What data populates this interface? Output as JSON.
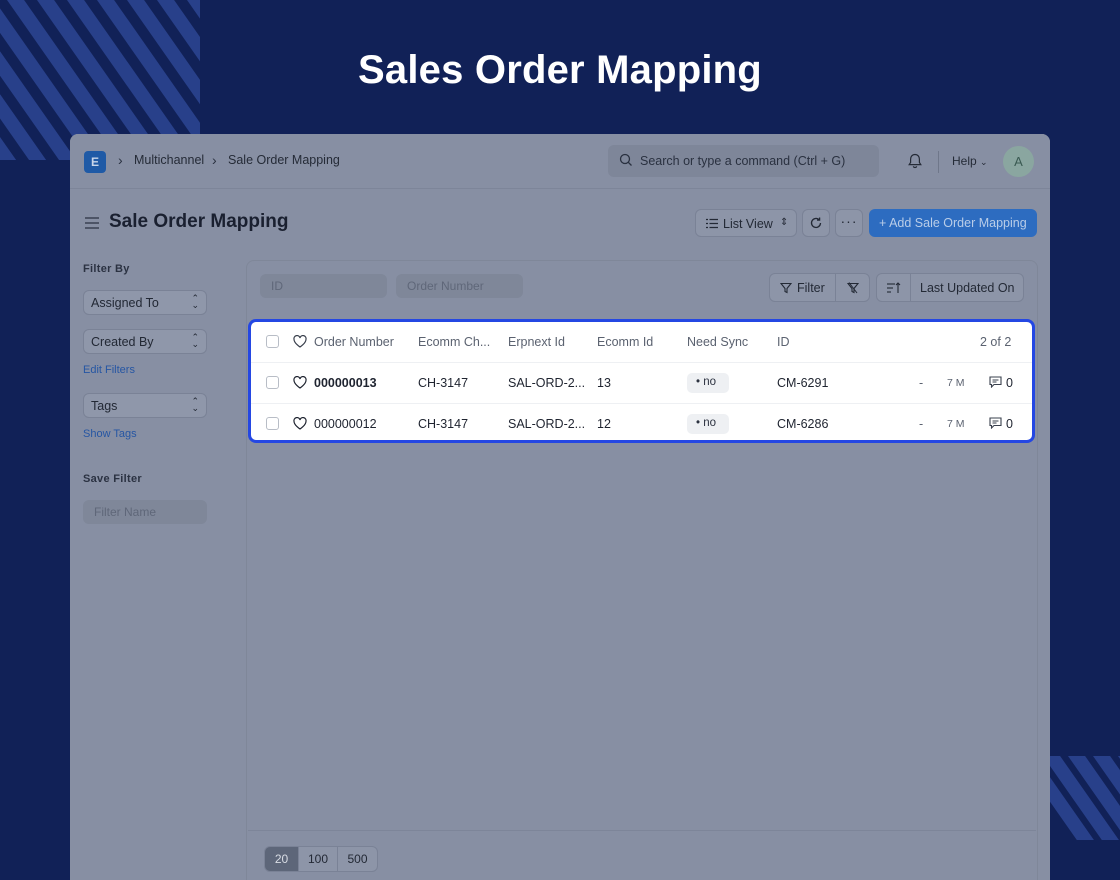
{
  "hero": {
    "title": "Sales Order Mapping"
  },
  "navbar": {
    "logo_letter": "E",
    "breadcrumbs": [
      "Multichannel",
      "Sale Order Mapping"
    ],
    "search_placeholder": "Search or type a command (Ctrl + G)",
    "help_label": "Help",
    "avatar_letter": "A"
  },
  "page": {
    "title": "Sale Order Mapping",
    "list_view_label": "List View",
    "more_label": "···",
    "primary_action": "+ Add Sale Order Mapping"
  },
  "sidebar": {
    "filter_by_label": "Filter By",
    "assigned_to": "Assigned To",
    "created_by": "Created By",
    "edit_filters": "Edit Filters",
    "tags": "Tags",
    "show_tags": "Show Tags",
    "save_filter_label": "Save Filter",
    "filter_name_placeholder": "Filter Name"
  },
  "list": {
    "id_placeholder": "ID",
    "order_number_placeholder": "Order Number",
    "filter_label": "Filter",
    "sort_label": "Last Updated On",
    "columns": [
      "Order Number",
      "Ecomm Ch...",
      "Erpnext Id",
      "Ecomm Id",
      "Need Sync",
      "ID"
    ],
    "count": "2 of 2",
    "rows": [
      {
        "order_number": "000000013",
        "ecomm_channel": "CH-3147",
        "erpnext_id": "SAL-ORD-2...",
        "ecomm_id": "13",
        "need_sync": "• no",
        "id": "CM-6291",
        "assigned": "-",
        "modified": "7 M",
        "comments": "0"
      },
      {
        "order_number": "000000012",
        "ecomm_channel": "CH-3147",
        "erpnext_id": "SAL-ORD-2...",
        "ecomm_id": "12",
        "need_sync": "• no",
        "id": "CM-6286",
        "assigned": "-",
        "modified": "7 M",
        "comments": "0"
      }
    ],
    "page_sizes": [
      "20",
      "100",
      "500"
    ]
  },
  "colors": {
    "background": "#112157",
    "highlight": "#2447e3",
    "primary": "#2d6cc0"
  }
}
